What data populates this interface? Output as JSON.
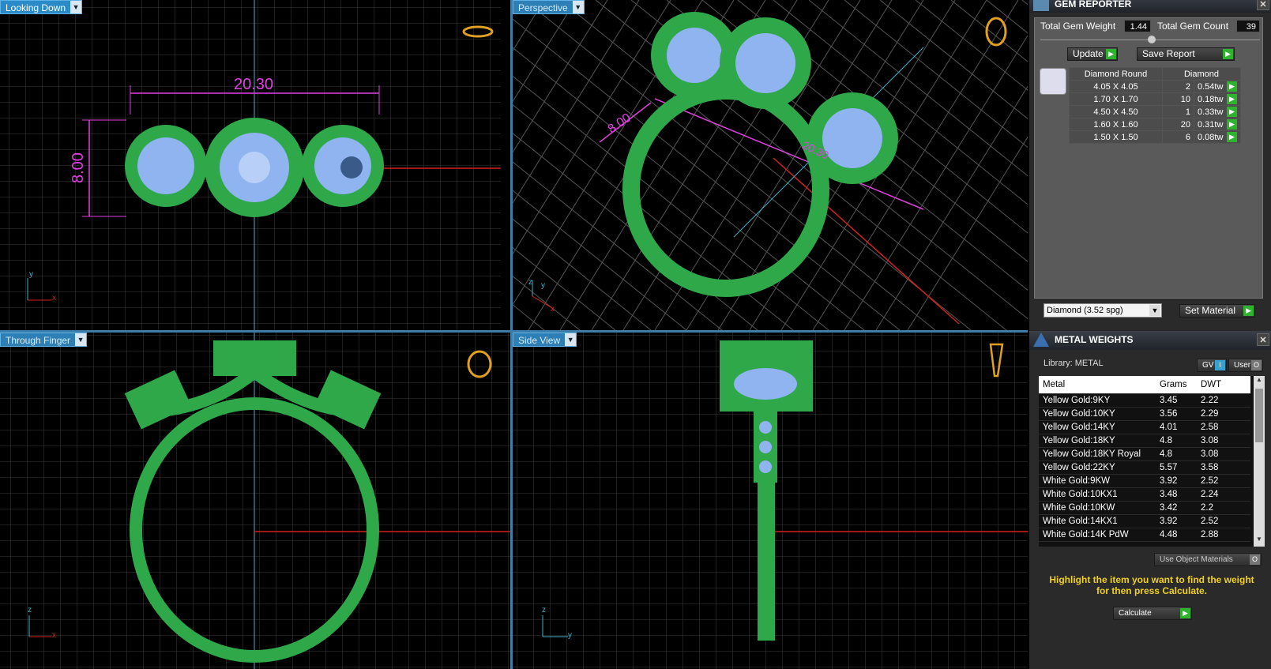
{
  "viewports": {
    "top_left": {
      "label": "Looking Down",
      "dim_width": "20.30",
      "dim_height": "8.00",
      "axes": [
        "y",
        "x"
      ]
    },
    "top_right": {
      "label": "Perspective",
      "dim_width": "8.00",
      "dim_length": "20.30",
      "axes": [
        "z",
        "y",
        "x"
      ]
    },
    "bottom_left": {
      "label": "Through Finger",
      "axes": [
        "z",
        "x"
      ]
    },
    "bottom_right": {
      "label": "Side View",
      "axes": [
        "z",
        "y"
      ]
    }
  },
  "gem_reporter": {
    "title": "GEM REPORTER",
    "total_weight_label": "Total Gem Weight",
    "total_weight_value": "1.44",
    "total_count_label": "Total Gem Count",
    "total_count_value": "39",
    "update_label": "Update",
    "save_label": "Save Report",
    "table_headers": [
      "Diamond Round",
      "Diamond"
    ],
    "rows": [
      {
        "size": "4.05 X 4.05",
        "count": "2",
        "weight": "0.54tw"
      },
      {
        "size": "1.70 X 1.70",
        "count": "10",
        "weight": "0.18tw"
      },
      {
        "size": "4.50 X 4.50",
        "count": "1",
        "weight": "0.33tw"
      },
      {
        "size": "1.60 X 1.60",
        "count": "20",
        "weight": "0.31tw"
      },
      {
        "size": "1.50 X 1.50",
        "count": "6",
        "weight": "0.08tw"
      }
    ],
    "material_select": "Diamond     (3.52 spg)",
    "set_material_label": "Set Material"
  },
  "metal_weights": {
    "title": "METAL WEIGHTS",
    "library_label": "Library: METAL",
    "toggle_gv": "GV",
    "toggle_user": "User",
    "headers": [
      "Metal",
      "Grams",
      "DWT"
    ],
    "rows": [
      {
        "metal": "Yellow Gold:9KY",
        "grams": "3.45",
        "dwt": "2.22"
      },
      {
        "metal": "Yellow Gold:10KY",
        "grams": "3.56",
        "dwt": "2.29"
      },
      {
        "metal": "Yellow Gold:14KY",
        "grams": "4.01",
        "dwt": "2.58"
      },
      {
        "metal": "Yellow Gold:18KY",
        "grams": "4.8",
        "dwt": "3.08"
      },
      {
        "metal": "Yellow Gold:18KY Royal",
        "grams": "4.8",
        "dwt": "3.08"
      },
      {
        "metal": "Yellow Gold:22KY",
        "grams": "5.57",
        "dwt": "3.58"
      },
      {
        "metal": "White Gold:9KW",
        "grams": "3.92",
        "dwt": "2.52"
      },
      {
        "metal": "White Gold:10KX1",
        "grams": "3.48",
        "dwt": "2.24"
      },
      {
        "metal": "White Gold:10KW",
        "grams": "3.42",
        "dwt": "2.2"
      },
      {
        "metal": "White Gold:14KX1",
        "grams": "3.92",
        "dwt": "2.52"
      },
      {
        "metal": "White Gold:14K PdW",
        "grams": "4.48",
        "dwt": "2.88"
      }
    ],
    "use_object_materials": "Use Object Materials",
    "hint": "Highlight the item you want to find the weight for then press Calculate.",
    "calculate_label": "Calculate"
  },
  "colors": {
    "ring": "#2fa84a",
    "gem": "#8fb4f0",
    "dimension": "#e040e0",
    "grid": "#3a3a3a",
    "axis_red": "#d42020",
    "axis_cyan": "#40b0c8"
  }
}
